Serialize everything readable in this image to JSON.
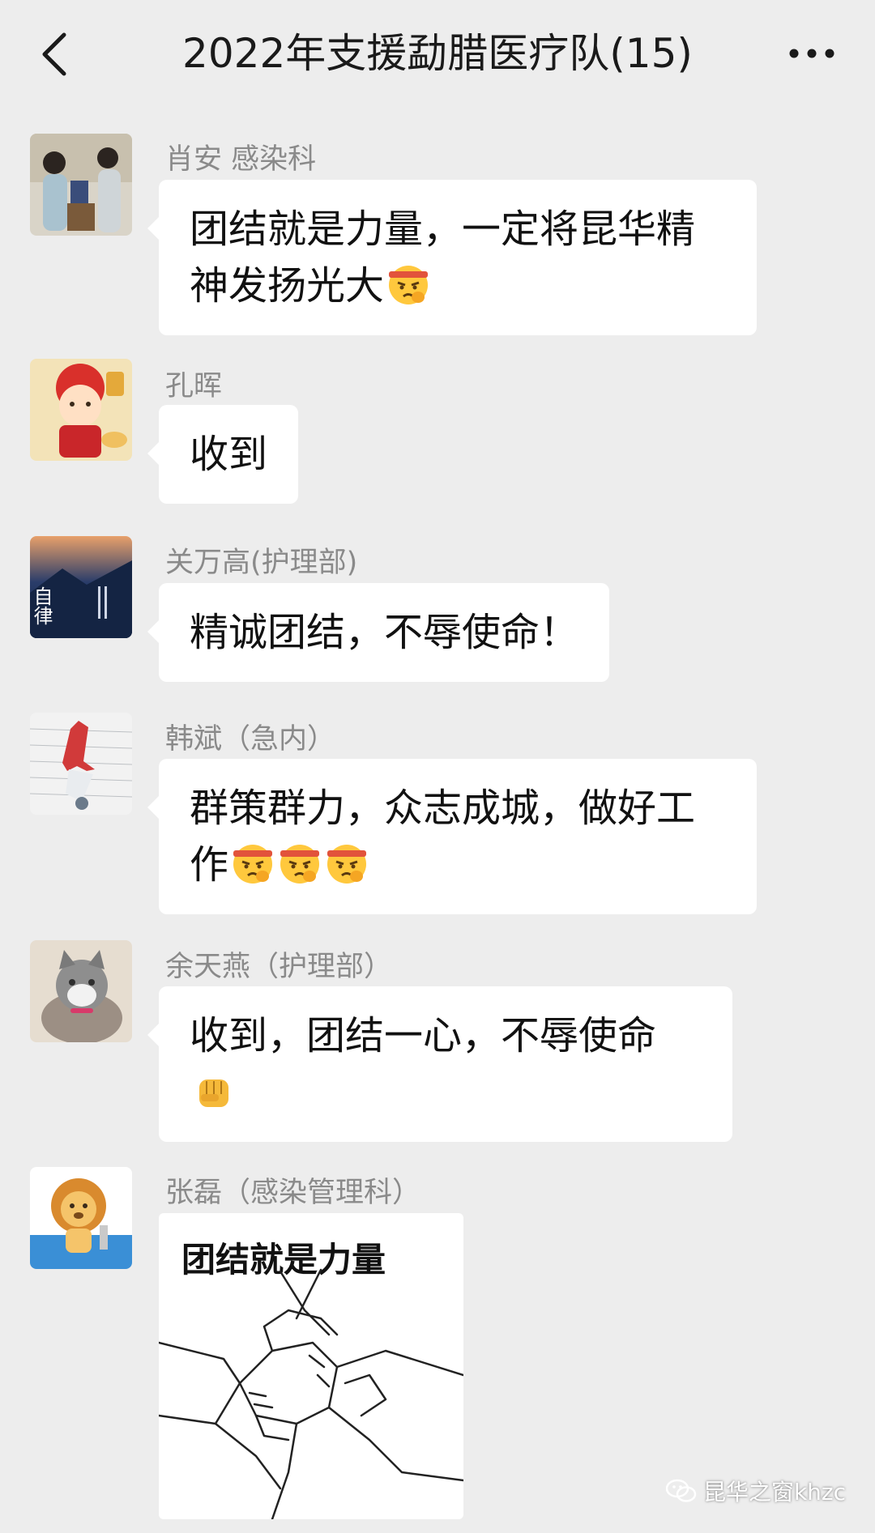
{
  "header": {
    "title": "2022年支援勐腊医疗队(15)",
    "back_icon": "chevron-left-icon",
    "more_icon": "more-dots-icon"
  },
  "messages": [
    {
      "sender": "肖安 感染科",
      "text": "团结就是力量，一定将昆华精神发扬光大",
      "emoji_count": 1,
      "emoji": "determined-face-emoji"
    },
    {
      "sender": "孔晖",
      "text": "收到"
    },
    {
      "sender": "关万高(护理部)",
      "text": "精诚团结，不辱使命！"
    },
    {
      "sender": "韩斌（急内）",
      "text": "群策群力，众志成城，做好工作",
      "emoji_count": 3,
      "emoji": "determined-face-emoji"
    },
    {
      "sender": "余天燕（护理部）",
      "text": "收到，团结一心，不辱使命",
      "emoji_count": 1,
      "emoji": "raised-fist-emoji"
    },
    {
      "sender": "张磊（感染管理科）",
      "image_caption": "团结就是力量"
    }
  ],
  "avatar_text": {
    "zilv": "自律"
  },
  "watermark": {
    "text": "昆华之窗khzc",
    "icon": "wechat-icon"
  },
  "colors": {
    "background": "#EDEDED",
    "bubble": "#FFFFFF",
    "sender_text": "#8A8A8A"
  }
}
